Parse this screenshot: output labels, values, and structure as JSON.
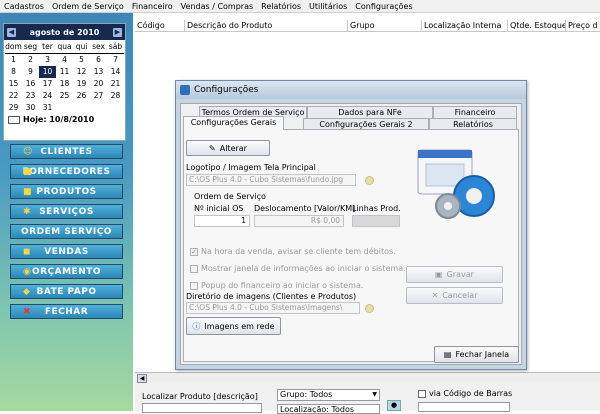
{
  "menu": [
    "Cadastros",
    "Ordem de Serviço",
    "Financeiro",
    "Vendas / Compras",
    "Relatórios",
    "Utilitários",
    "Configurações"
  ],
  "calendar": {
    "month_label": "agosto de 2010",
    "prev": "◀",
    "next": "▶",
    "weekdays": [
      "dom",
      "seg",
      "ter",
      "qua",
      "qui",
      "sex",
      "sáb"
    ],
    "weeks": [
      [
        "1",
        "2",
        "3",
        "4",
        "5",
        "6",
        "7"
      ],
      [
        "8",
        "9",
        "10",
        "11",
        "12",
        "13",
        "14"
      ],
      [
        "15",
        "16",
        "17",
        "18",
        "19",
        "20",
        "21"
      ],
      [
        "22",
        "23",
        "24",
        "25",
        "26",
        "27",
        "28"
      ],
      [
        "29",
        "30",
        "31",
        "",
        "",
        "",
        ""
      ]
    ],
    "selected_day": "10",
    "today_label": "Hoje: 10/8/2010"
  },
  "nav": [
    "CLIENTES",
    "FORNECEDORES",
    "PRODUTOS",
    "SERVIÇOS",
    "ORDEM SERVIÇO",
    "VENDAS",
    "ORÇAMENTO",
    "BATE PAPO",
    "FECHAR"
  ],
  "grid_columns": [
    "Código",
    "Descrição do Produto",
    "Grupo",
    "Localização Interna",
    "Qtde. Estoque",
    "Preço d"
  ],
  "bottom": {
    "localizar_label": "Localizar Produto [descrição]",
    "grupo_value": "Grupo: Todos",
    "local_value": "Localização: Todos",
    "barras_label": "via Código de Barras"
  },
  "dialog": {
    "title": "Configurações",
    "tabs_row1": [
      "Termos Ordem de Serviço",
      "Dados para NFe",
      "Financeiro"
    ],
    "tabs_row2": [
      "Configurações Gerais",
      "Configurações Gerais 2",
      "Relatórios"
    ],
    "alterar_label": "Alterar",
    "logo_label": "Logotipo / Imagem Tela Principal",
    "logo_path": "C:\\OS Plus 4.0 - Cubo Sistemas\\fundo.jpg",
    "os_group_label": "Ordem de Serviço",
    "inicial_label": "Nº inicial OS",
    "inicial_value": "1",
    "desloc_label": "Deslocamento [Valor/KM]",
    "desloc_value": "R$ 0,00",
    "linhas_label": "Linhas Prod.",
    "chk_venda": "Na hora da venda, avisar se cliente tem débitos.",
    "chk_janela": "Mostrar janela de informações ao iniciar o sistema.",
    "chk_popup": "Popup do financeiro ao iniciar o sistema.",
    "gravar_label": "Gravar",
    "cancelar_label": "Cancelar",
    "dir_label": "Diretório de imagens (Clientes e Produtos)",
    "dir_path": "C:\\OS Plus 4.0 - Cubo Sistemas\\Imagens\\",
    "rede_label": "Imagens em rede",
    "fechar_label": "Fechar Janela"
  }
}
